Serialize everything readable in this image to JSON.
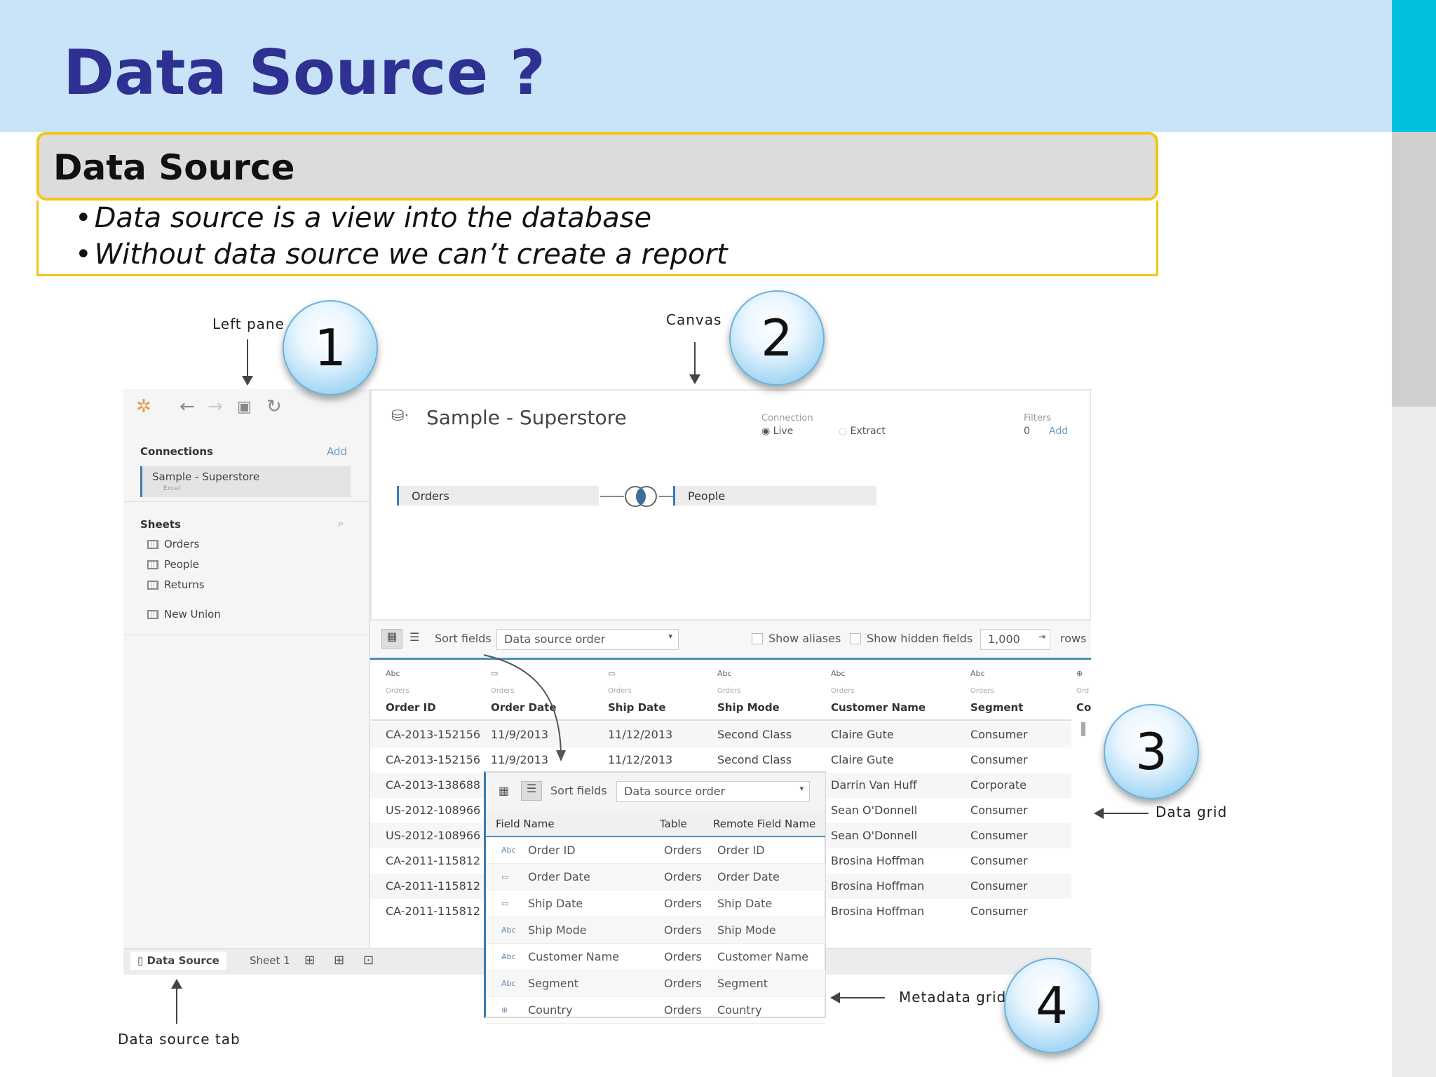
{
  "slide": {
    "title": "Data Source ?",
    "box_heading": "Data Source",
    "bullets": [
      "Data source is a view into the database",
      "Without data source we can’t create a report"
    ]
  },
  "callouts": {
    "c1": {
      "number": "1",
      "label": "Left pane"
    },
    "c2": {
      "number": "2",
      "label": "Canvas"
    },
    "c3": {
      "number": "3",
      "label": "Data grid"
    },
    "c4": {
      "number": "4",
      "label": "Metadata grid"
    },
    "tab_label": "Data source tab"
  },
  "left_pane": {
    "connections_label": "Connections",
    "add_label": "Add",
    "connection_name": "Sample - Superstore",
    "connection_type": "Excel",
    "sheets_label": "Sheets",
    "sheets": [
      "Orders",
      "People",
      "Returns"
    ],
    "new_union": "New Union"
  },
  "canvas": {
    "datasource_name": "Sample - Superstore",
    "connection_label": "Connection",
    "live_label": "Live",
    "extract_label": "Extract",
    "filters_label": "Filters",
    "filters_count": "0",
    "filters_add": "Add",
    "table_left": "Orders",
    "table_right": "People"
  },
  "grid_toolbar": {
    "sort_label": "Sort fields",
    "sort_value": "Data source order",
    "show_aliases": "Show aliases",
    "show_hidden": "Show hidden fields",
    "rows_value": "1,000",
    "rows_label": "rows"
  },
  "data_grid": {
    "columns": [
      {
        "type": "Abc",
        "source": "Orders",
        "name": "Order ID"
      },
      {
        "type": "▭",
        "source": "Orders",
        "name": "Order Date"
      },
      {
        "type": "▭",
        "source": "Orders",
        "name": "Ship Date"
      },
      {
        "type": "Abc",
        "source": "Orders",
        "name": "Ship Mode"
      },
      {
        "type": "Abc",
        "source": "Orders",
        "name": "Customer Name"
      },
      {
        "type": "Abc",
        "source": "Orders",
        "name": "Segment"
      },
      {
        "type": "⊕",
        "source": "Ord",
        "name": "Co"
      }
    ],
    "rows": [
      [
        "CA-2013-152156",
        "11/9/2013",
        "11/12/2013",
        "Second Class",
        "Claire Gute",
        "Consumer"
      ],
      [
        "CA-2013-152156",
        "11/9/2013",
        "11/12/2013",
        "Second Class",
        "Claire Gute",
        "Consumer"
      ],
      [
        "CA-2013-138688",
        "",
        "",
        "",
        "Darrin Van Huff",
        "Corporate"
      ],
      [
        "US-2012-108966",
        "",
        "",
        "",
        "Sean O'Donnell",
        "Consumer"
      ],
      [
        "US-2012-108966",
        "",
        "",
        "",
        "Sean O'Donnell",
        "Consumer"
      ],
      [
        "CA-2011-115812",
        "",
        "",
        "",
        "Brosina Hoffman",
        "Consumer"
      ],
      [
        "CA-2011-115812",
        "",
        "",
        "",
        "Brosina Hoffman",
        "Consumer"
      ],
      [
        "CA-2011-115812",
        "",
        "",
        "",
        "Brosina Hoffman",
        "Consumer"
      ]
    ]
  },
  "bottom_tabs": {
    "data_source": "Data Source",
    "sheet1": "Sheet 1"
  },
  "metadata_grid": {
    "sort_label": "Sort fields",
    "sort_value": "Data source order",
    "headers": [
      "Field Name",
      "Table",
      "Remote Field Name"
    ],
    "rows": [
      {
        "type": "Abc",
        "field": "Order ID",
        "table": "Orders",
        "remote": "Order ID"
      },
      {
        "type": "▭",
        "field": "Order Date",
        "table": "Orders",
        "remote": "Order Date"
      },
      {
        "type": "▭",
        "field": "Ship Date",
        "table": "Orders",
        "remote": "Ship Date"
      },
      {
        "type": "Abc",
        "field": "Ship Mode",
        "table": "Orders",
        "remote": "Ship Mode"
      },
      {
        "type": "Abc",
        "field": "Customer Name",
        "table": "Orders",
        "remote": "Customer Name"
      },
      {
        "type": "Abc",
        "field": "Segment",
        "table": "Orders",
        "remote": "Segment"
      },
      {
        "type": "⊕",
        "field": "Country",
        "table": "Orders",
        "remote": "Country"
      }
    ]
  }
}
